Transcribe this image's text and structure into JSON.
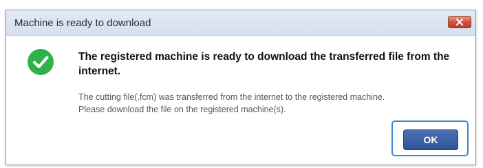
{
  "dialog": {
    "title": "Machine is ready to download",
    "close_icon": "close-icon",
    "status_icon": "checkmark-circle-icon",
    "headline": "The registered machine is ready to download the transferred file from the internet.",
    "detail_lines": [
      "The cutting file(.fcm) was transferred from the internet to the registered machine.",
      "Please download the file on the registered machine(s)."
    ],
    "ok_label": "OK"
  },
  "colors": {
    "accent": "#2f5596",
    "success": "#2fb24a",
    "close_button": "#c9503c"
  }
}
